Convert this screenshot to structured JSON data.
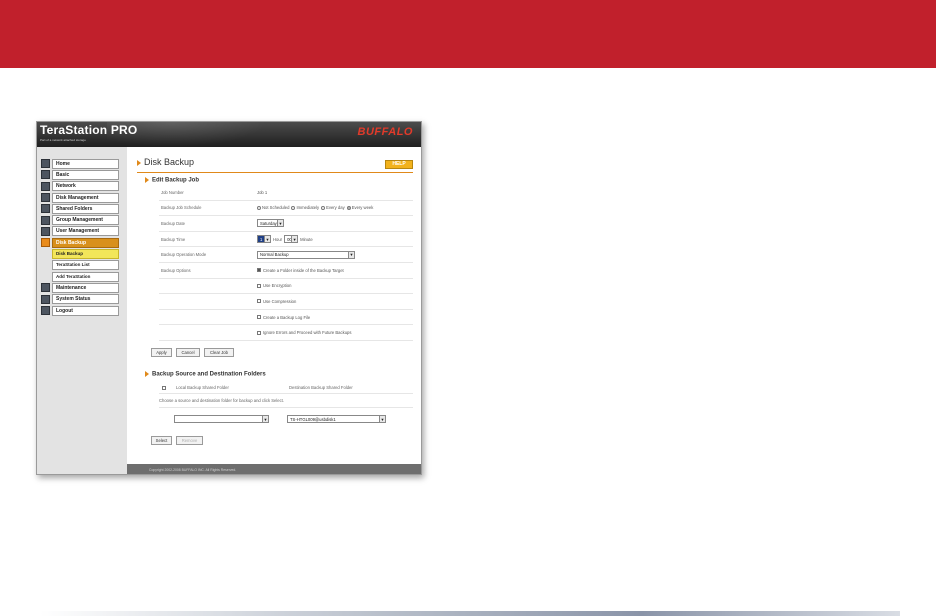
{
  "app": {
    "brand": "TeraStation PRO",
    "tagline": "Part of a network attached storage",
    "logo": "BUFFALO",
    "footer": "Copyright 2002-2008 BUFFALO INC. All Rights Reserved.",
    "colors": {
      "accent_red": "#c1202c",
      "header": "#2a2a2a",
      "nav_active": "#d8901c",
      "sub_active": "#f2e65a",
      "help": "#f2b21c"
    }
  },
  "sidebar": {
    "items": [
      {
        "label": "Home",
        "icon": "home-icon"
      },
      {
        "label": "Basic",
        "icon": "basic-icon"
      },
      {
        "label": "Network",
        "icon": "network-icon"
      },
      {
        "label": "Disk Management",
        "icon": "disk-icon"
      },
      {
        "label": "Shared Folders",
        "icon": "folder-icon"
      },
      {
        "label": "Group Management",
        "icon": "group-icon"
      },
      {
        "label": "User Management",
        "icon": "user-icon"
      },
      {
        "label": "Disk Backup",
        "icon": "backup-icon"
      }
    ],
    "subitems": [
      {
        "label": "Disk Backup"
      },
      {
        "label": "TeraStation List"
      },
      {
        "label": "Add TeraStation"
      }
    ],
    "bottom_items": [
      {
        "label": "Maintenance",
        "icon": "maintenance-icon"
      },
      {
        "label": "System Status",
        "icon": "status-icon"
      },
      {
        "label": "Logout",
        "icon": "logout-icon"
      }
    ]
  },
  "page": {
    "title": "Disk Backup",
    "help_label": "HELP",
    "section1": "Edit Backup Job",
    "section2": "Backup Source and Destination Folders"
  },
  "form": {
    "job_number": {
      "label": "Job Number",
      "value": "Job 1"
    },
    "schedule": {
      "label": "Backup Job Schedule",
      "options": [
        "Not Scheduled",
        "Immediately",
        "Every day",
        "Every week"
      ],
      "selected": "Every week"
    },
    "date": {
      "label": "Backup Date",
      "value": "Saturday"
    },
    "time": {
      "label": "Backup Time",
      "hour": "1",
      "hour_unit": "Hour",
      "minute": "00",
      "minute_unit": "Minute"
    },
    "mode": {
      "label": "Backup Operation Mode",
      "value": "Normal Backup"
    },
    "options": {
      "label": "Backup Options",
      "items": [
        {
          "label": "Create a Folder inside of the Backup Target",
          "checked": true
        },
        {
          "label": "Use Encryption",
          "checked": false
        },
        {
          "label": "Use Compression",
          "checked": false
        },
        {
          "label": "Create a Backup Log File",
          "checked": false
        },
        {
          "label": "Ignore Errors and Proceed with Future Backups",
          "checked": false
        }
      ]
    },
    "buttons": {
      "apply": "Apply",
      "cancel": "Cancel",
      "clear": "Clear Job"
    }
  },
  "folders": {
    "col_local": "Local Backup Shared Folder",
    "col_dest": "Destination Backup Shared Folder",
    "instruction": "Choose a source and destination folder for backup and click Select.",
    "source_value": "",
    "dest_value": "TS-HTGL009@usbdisk1",
    "select_label": "Select",
    "remove_label": "Remove"
  }
}
